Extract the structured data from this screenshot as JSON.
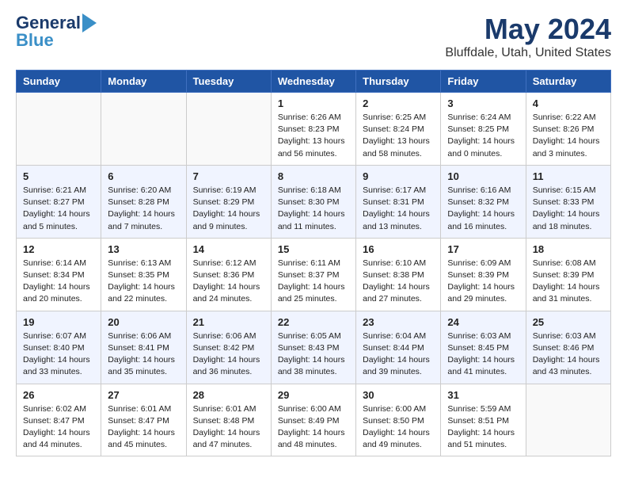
{
  "logo": {
    "line1": "General",
    "line2": "Blue"
  },
  "title": "May 2024",
  "location": "Bluffdale, Utah, United States",
  "headers": [
    "Sunday",
    "Monday",
    "Tuesday",
    "Wednesday",
    "Thursday",
    "Friday",
    "Saturday"
  ],
  "weeks": [
    [
      {
        "day": "",
        "info": ""
      },
      {
        "day": "",
        "info": ""
      },
      {
        "day": "",
        "info": ""
      },
      {
        "day": "1",
        "info": "Sunrise: 6:26 AM\nSunset: 8:23 PM\nDaylight: 13 hours\nand 56 minutes."
      },
      {
        "day": "2",
        "info": "Sunrise: 6:25 AM\nSunset: 8:24 PM\nDaylight: 13 hours\nand 58 minutes."
      },
      {
        "day": "3",
        "info": "Sunrise: 6:24 AM\nSunset: 8:25 PM\nDaylight: 14 hours\nand 0 minutes."
      },
      {
        "day": "4",
        "info": "Sunrise: 6:22 AM\nSunset: 8:26 PM\nDaylight: 14 hours\nand 3 minutes."
      }
    ],
    [
      {
        "day": "5",
        "info": "Sunrise: 6:21 AM\nSunset: 8:27 PM\nDaylight: 14 hours\nand 5 minutes."
      },
      {
        "day": "6",
        "info": "Sunrise: 6:20 AM\nSunset: 8:28 PM\nDaylight: 14 hours\nand 7 minutes."
      },
      {
        "day": "7",
        "info": "Sunrise: 6:19 AM\nSunset: 8:29 PM\nDaylight: 14 hours\nand 9 minutes."
      },
      {
        "day": "8",
        "info": "Sunrise: 6:18 AM\nSunset: 8:30 PM\nDaylight: 14 hours\nand 11 minutes."
      },
      {
        "day": "9",
        "info": "Sunrise: 6:17 AM\nSunset: 8:31 PM\nDaylight: 14 hours\nand 13 minutes."
      },
      {
        "day": "10",
        "info": "Sunrise: 6:16 AM\nSunset: 8:32 PM\nDaylight: 14 hours\nand 16 minutes."
      },
      {
        "day": "11",
        "info": "Sunrise: 6:15 AM\nSunset: 8:33 PM\nDaylight: 14 hours\nand 18 minutes."
      }
    ],
    [
      {
        "day": "12",
        "info": "Sunrise: 6:14 AM\nSunset: 8:34 PM\nDaylight: 14 hours\nand 20 minutes."
      },
      {
        "day": "13",
        "info": "Sunrise: 6:13 AM\nSunset: 8:35 PM\nDaylight: 14 hours\nand 22 minutes."
      },
      {
        "day": "14",
        "info": "Sunrise: 6:12 AM\nSunset: 8:36 PM\nDaylight: 14 hours\nand 24 minutes."
      },
      {
        "day": "15",
        "info": "Sunrise: 6:11 AM\nSunset: 8:37 PM\nDaylight: 14 hours\nand 25 minutes."
      },
      {
        "day": "16",
        "info": "Sunrise: 6:10 AM\nSunset: 8:38 PM\nDaylight: 14 hours\nand 27 minutes."
      },
      {
        "day": "17",
        "info": "Sunrise: 6:09 AM\nSunset: 8:39 PM\nDaylight: 14 hours\nand 29 minutes."
      },
      {
        "day": "18",
        "info": "Sunrise: 6:08 AM\nSunset: 8:39 PM\nDaylight: 14 hours\nand 31 minutes."
      }
    ],
    [
      {
        "day": "19",
        "info": "Sunrise: 6:07 AM\nSunset: 8:40 PM\nDaylight: 14 hours\nand 33 minutes."
      },
      {
        "day": "20",
        "info": "Sunrise: 6:06 AM\nSunset: 8:41 PM\nDaylight: 14 hours\nand 35 minutes."
      },
      {
        "day": "21",
        "info": "Sunrise: 6:06 AM\nSunset: 8:42 PM\nDaylight: 14 hours\nand 36 minutes."
      },
      {
        "day": "22",
        "info": "Sunrise: 6:05 AM\nSunset: 8:43 PM\nDaylight: 14 hours\nand 38 minutes."
      },
      {
        "day": "23",
        "info": "Sunrise: 6:04 AM\nSunset: 8:44 PM\nDaylight: 14 hours\nand 39 minutes."
      },
      {
        "day": "24",
        "info": "Sunrise: 6:03 AM\nSunset: 8:45 PM\nDaylight: 14 hours\nand 41 minutes."
      },
      {
        "day": "25",
        "info": "Sunrise: 6:03 AM\nSunset: 8:46 PM\nDaylight: 14 hours\nand 43 minutes."
      }
    ],
    [
      {
        "day": "26",
        "info": "Sunrise: 6:02 AM\nSunset: 8:47 PM\nDaylight: 14 hours\nand 44 minutes."
      },
      {
        "day": "27",
        "info": "Sunrise: 6:01 AM\nSunset: 8:47 PM\nDaylight: 14 hours\nand 45 minutes."
      },
      {
        "day": "28",
        "info": "Sunrise: 6:01 AM\nSunset: 8:48 PM\nDaylight: 14 hours\nand 47 minutes."
      },
      {
        "day": "29",
        "info": "Sunrise: 6:00 AM\nSunset: 8:49 PM\nDaylight: 14 hours\nand 48 minutes."
      },
      {
        "day": "30",
        "info": "Sunrise: 6:00 AM\nSunset: 8:50 PM\nDaylight: 14 hours\nand 49 minutes."
      },
      {
        "day": "31",
        "info": "Sunrise: 5:59 AM\nSunset: 8:51 PM\nDaylight: 14 hours\nand 51 minutes."
      },
      {
        "day": "",
        "info": ""
      }
    ]
  ]
}
